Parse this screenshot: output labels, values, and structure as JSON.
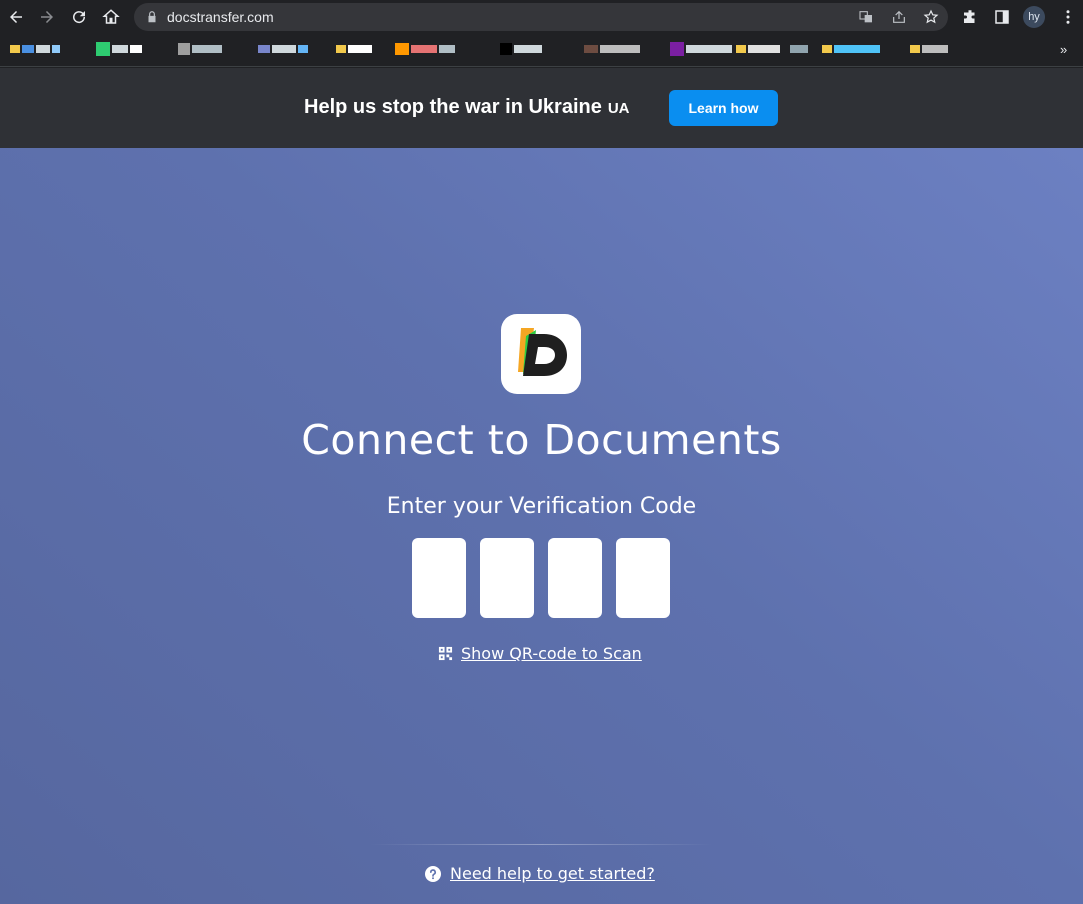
{
  "browser": {
    "url": "docstransfer.com",
    "profile_initials": "hy",
    "bookmarks_more": "»"
  },
  "banner": {
    "message": "Help us stop the war in Ukraine",
    "tag": "UA",
    "button_label": "Learn how"
  },
  "main": {
    "title": "Connect to Documents",
    "subtitle": "Enter your Verification Code",
    "code_digits": [
      "",
      "",
      "",
      ""
    ],
    "qr_link": "Show QR-code to Scan",
    "help_link": "Need help to get started?"
  },
  "colors": {
    "chrome_bg": "#202124",
    "banner_bg": "#2f3136",
    "accent": "#0a8ef0",
    "main_bg": "#5e71ae"
  }
}
